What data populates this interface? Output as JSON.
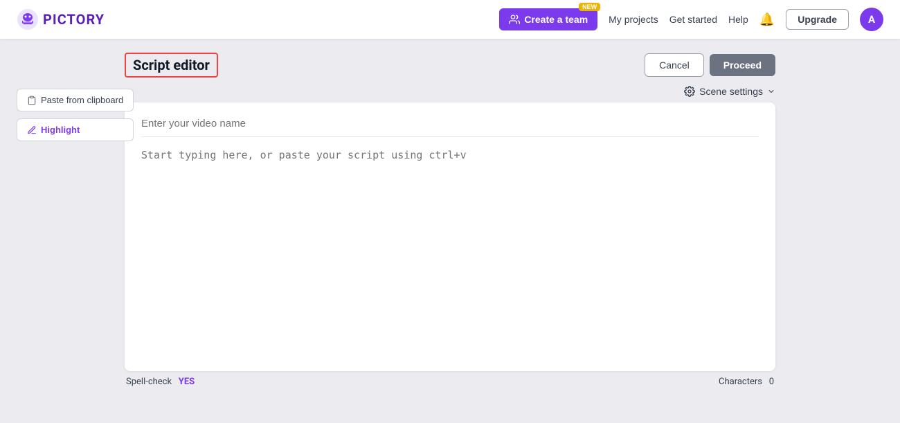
{
  "header": {
    "logo_text": "PICTORY",
    "create_team_label": "Create a team",
    "new_badge": "NEW",
    "my_projects": "My projects",
    "get_started": "Get started",
    "help": "Help",
    "upgrade": "Upgrade",
    "avatar_initial": "A"
  },
  "page": {
    "title": "Script editor",
    "cancel_label": "Cancel",
    "proceed_label": "Proceed",
    "scene_settings_label": "Scene settings"
  },
  "tools": {
    "paste_from_clipboard": "Paste from clipboard",
    "highlight": "Highlight"
  },
  "editor": {
    "video_name_placeholder": "Enter your video name",
    "script_placeholder": "Start typing here, or paste your script using ctrl+v"
  },
  "footer": {
    "spell_check_label": "Spell-check",
    "spell_check_value": "YES",
    "characters_label": "Characters",
    "characters_value": "0"
  }
}
